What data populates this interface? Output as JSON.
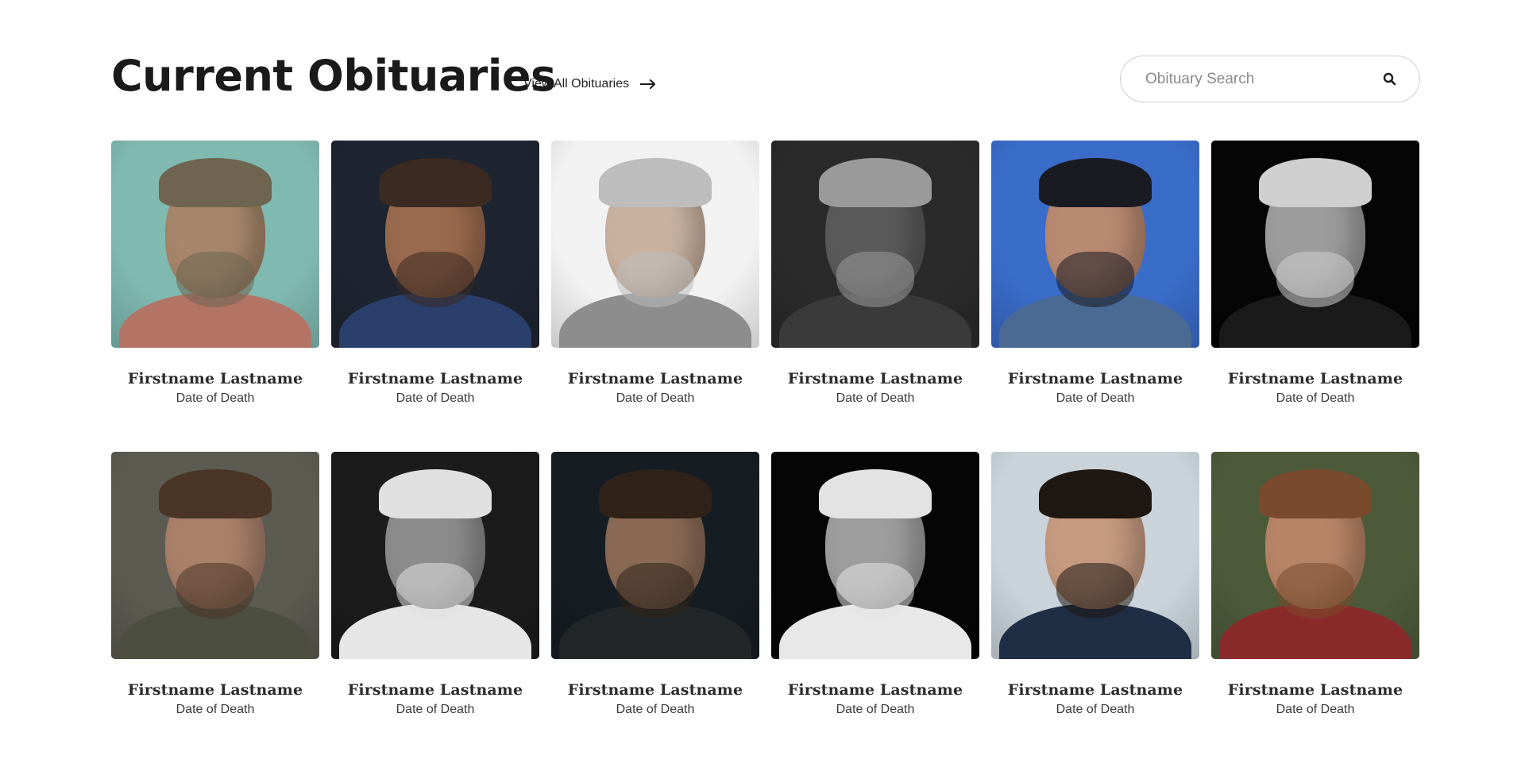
{
  "header": {
    "title": "Current Obituaries",
    "view_all_label": "View All Obituaries",
    "view_all_icon": "arrow-right-icon",
    "search_placeholder": "Obituary Search",
    "search_icon": "search-icon"
  },
  "obituaries": [
    {
      "name": "Firstname Lastname",
      "date": "Date of Death",
      "bg": "#7fb9b0",
      "skin": "#a7876b",
      "hair": "#6e6450",
      "shirt": "#b37466"
    },
    {
      "name": "Firstname Lastname",
      "date": "Date of Death",
      "bg": "#1e2430",
      "skin": "#9a6a4e",
      "hair": "#3a2a22",
      "shirt": "#2a3f6b"
    },
    {
      "name": "Firstname Lastname",
      "date": "Date of Death",
      "bg": "#f2f2f2",
      "skin": "#c9b2a0",
      "hair": "#bdbdbd",
      "shirt": "#8d8d8d"
    },
    {
      "name": "Firstname Lastname",
      "date": "Date of Death",
      "bg": "#2a2a2a",
      "skin": "#5a5a5a",
      "hair": "#9a9a9a",
      "shirt": "#3a3a3a"
    },
    {
      "name": "Firstname Lastname",
      "date": "Date of Death",
      "bg": "#3a6cc9",
      "skin": "#b98a72",
      "hair": "#1a1a22",
      "shirt": "#4a6a93"
    },
    {
      "name": "Firstname Lastname",
      "date": "Date of Death",
      "bg": "#050505",
      "skin": "#9c9c9c",
      "hair": "#cfcfcf",
      "shirt": "#1a1a1a"
    },
    {
      "name": "Firstname Lastname",
      "date": "Date of Death",
      "bg": "#5b5b52",
      "skin": "#a9806a",
      "hair": "#4a3526",
      "shirt": "#4c4e40"
    },
    {
      "name": "Firstname Lastname",
      "date": "Date of Death",
      "bg": "#1b1b1b",
      "skin": "#8c8c8c",
      "hair": "#e0e0e0",
      "shirt": "#e6e6e6"
    },
    {
      "name": "Firstname Lastname",
      "date": "Date of Death",
      "bg": "#151c22",
      "skin": "#8a6a55",
      "hair": "#2e2219",
      "shirt": "#222629"
    },
    {
      "name": "Firstname Lastname",
      "date": "Date of Death",
      "bg": "#050505",
      "skin": "#9d9d9d",
      "hair": "#e3e3e3",
      "shirt": "#e8e8e8"
    },
    {
      "name": "Firstname Lastname",
      "date": "Date of Death",
      "bg": "#c9d3d9",
      "skin": "#c59a80",
      "hair": "#1f1712",
      "shirt": "#1e2e45"
    },
    {
      "name": "Firstname Lastname",
      "date": "Date of Death",
      "bg": "#4d5a3a",
      "skin": "#b88466",
      "hair": "#7a4a2c",
      "shirt": "#8a2b2b"
    }
  ]
}
